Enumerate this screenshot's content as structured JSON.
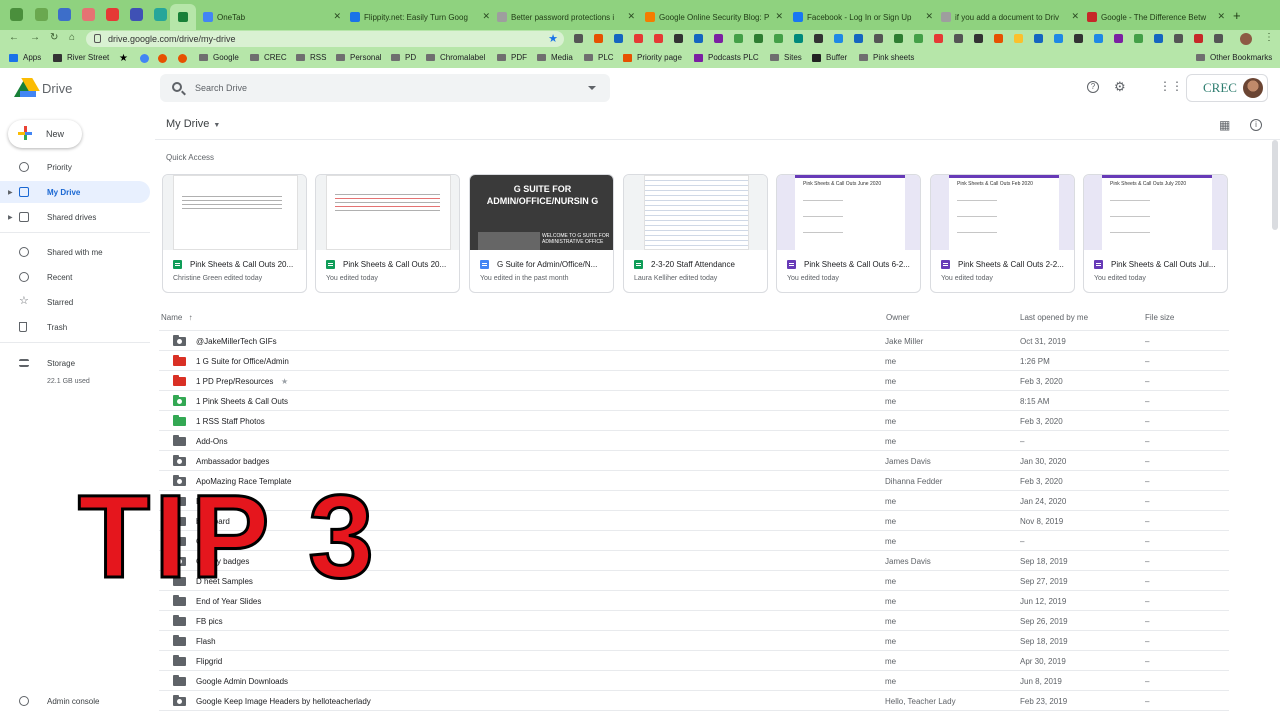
{
  "browser": {
    "tabs": [
      {
        "label": "OneTab",
        "color": "#4285f4"
      },
      {
        "label": "Flippity.net: Easily Turn Goog",
        "color": "#1a73e8"
      },
      {
        "label": "Better password protections i",
        "color": "#9e9e9e"
      },
      {
        "label": "Google Online Security Blog: P",
        "color": "#f57c00"
      },
      {
        "label": "Facebook - Log In or Sign Up",
        "color": "#1877f2"
      },
      {
        "label": "if you add a document to Driv",
        "color": "#9e9e9e"
      },
      {
        "label": "Google - The Difference Betw",
        "color": "#c62828"
      }
    ],
    "url": "drive.google.com/drive/my-drive",
    "bookmarks": [
      "Apps",
      "River Street",
      "Google",
      "CREC",
      "RSS",
      "Personal",
      "PD",
      "Chromalabel",
      "PDF",
      "Media",
      "PLC",
      "Priority page",
      "Podcasts PLC",
      "Sites",
      "Buffer",
      "Pink sheets"
    ],
    "other_bookmarks": "Other Bookmarks"
  },
  "header": {
    "app_name": "Drive",
    "search_placeholder": "Search Drive",
    "brand": "CREC"
  },
  "sidebar": {
    "new_label": "New",
    "items": [
      {
        "label": "Priority"
      },
      {
        "label": "My Drive"
      },
      {
        "label": "Shared drives"
      },
      {
        "label": "Shared with me"
      },
      {
        "label": "Recent"
      },
      {
        "label": "Starred"
      },
      {
        "label": "Trash"
      },
      {
        "label": "Storage"
      }
    ],
    "storage_used": "22.1 GB used",
    "admin_console": "Admin console"
  },
  "main": {
    "title": "My Drive",
    "quick_access_label": "Quick Access",
    "quick_access": [
      {
        "name": "Pink Sheets & Call Outs 20...",
        "sub": "Christine Green edited today",
        "type": "sheet"
      },
      {
        "name": "Pink Sheets & Call Outs 20...",
        "sub": "You edited today",
        "type": "sheet"
      },
      {
        "name": "G Suite for Admin/Office/N...",
        "sub": "You edited in the past month",
        "type": "doc",
        "banner": "G SUITE FOR ADMIN/OFFICE/NURSIN G",
        "welcome": "WELCOME TO G SUITE FOR ADMINISTRATIVE OFFICE"
      },
      {
        "name": "2-3-20 Staff Attendance",
        "sub": "Laura Kelliher edited today",
        "type": "sheet"
      },
      {
        "name": "Pink Sheets & Call Outs 6-2...",
        "sub": "You edited today",
        "type": "form",
        "form_title": "Pink Sheets & Call Outs June 2020"
      },
      {
        "name": "Pink Sheets & Call Outs 2-2...",
        "sub": "You edited today",
        "type": "form",
        "form_title": "Pink Sheets & Call Outs Feb 2020"
      },
      {
        "name": "Pink Sheets & Call Outs Jul...",
        "sub": "You edited today",
        "type": "form",
        "form_title": "Pink Sheets & Call Outs July 2020"
      }
    ],
    "columns": {
      "name": "Name",
      "owner": "Owner",
      "last_opened": "Last opened by me",
      "size": "File size"
    },
    "files": [
      {
        "name": "@JakeMillerTech GIFs",
        "owner": "Jake Miller",
        "opened": "Oct 31, 2019",
        "size": "–",
        "color": "#5f6368",
        "shared": true
      },
      {
        "name": "1 G Suite for Office/Admin",
        "owner": "me",
        "opened": "1:26 PM",
        "size": "–",
        "color": "#d93025",
        "shared": false
      },
      {
        "name": "1 PD Prep/Resources",
        "owner": "me",
        "opened": "Feb 3, 2020",
        "size": "–",
        "color": "#d93025",
        "shared": false,
        "starred": true
      },
      {
        "name": "1 Pink Sheets & Call Outs",
        "owner": "me",
        "opened": "8:15 AM",
        "size": "–",
        "color": "#33a853",
        "shared": true
      },
      {
        "name": "1 RSS Staff Photos",
        "owner": "me",
        "opened": "Feb 3, 2020",
        "size": "–",
        "color": "#33a853",
        "shared": false
      },
      {
        "name": "Add-Ons",
        "owner": "me",
        "opened": "–",
        "size": "–",
        "color": "#5f6368",
        "shared": false
      },
      {
        "name": "Ambassador badges",
        "owner": "James Davis",
        "opened": "Jan 30, 2020",
        "size": "–",
        "color": "#5f6368",
        "shared": true
      },
      {
        "name": "ApoMazing Race Template",
        "owner": "Dihanna Fedder",
        "opened": "Feb 3, 2020",
        "size": "–",
        "color": "#5f6368",
        "shared": true
      },
      {
        "name": "B",
        "owner": "me",
        "opened": "Jan 24, 2020",
        "size": "–",
        "color": "#5f6368",
        "shared": false
      },
      {
        "name": "b  n board",
        "owner": "me",
        "opened": "Nov 8, 2019",
        "size": "–",
        "color": "#5f6368",
        "shared": false
      },
      {
        "name": "C",
        "owner": "me",
        "opened": "–",
        "size": "–",
        "color": "#5f6368",
        "shared": false
      },
      {
        "name": "C    unity badges",
        "owner": "James Davis",
        "opened": "Sep 18, 2019",
        "size": "–",
        "color": "#5f6368",
        "shared": true
      },
      {
        "name": "D   heet Samples",
        "owner": "me",
        "opened": "Sep 27, 2019",
        "size": "–",
        "color": "#5f6368",
        "shared": false
      },
      {
        "name": "End of Year Slides",
        "owner": "me",
        "opened": "Jun 12, 2019",
        "size": "–",
        "color": "#5f6368",
        "shared": false
      },
      {
        "name": "FB pics",
        "owner": "me",
        "opened": "Sep 26, 2019",
        "size": "–",
        "color": "#5f6368",
        "shared": false
      },
      {
        "name": "Flash",
        "owner": "me",
        "opened": "Sep 18, 2019",
        "size": "–",
        "color": "#5f6368",
        "shared": false
      },
      {
        "name": "Flipgrid",
        "owner": "me",
        "opened": "Apr 30, 2019",
        "size": "–",
        "color": "#5f6368",
        "shared": false
      },
      {
        "name": "Google Admin Downloads",
        "owner": "me",
        "opened": "Jun 8, 2019",
        "size": "–",
        "color": "#5f6368",
        "shared": false
      },
      {
        "name": "Google Keep Image Headers by helloteacherlady",
        "owner": "Hello, Teacher Lady",
        "opened": "Feb 23, 2019",
        "size": "–",
        "color": "#5f6368",
        "shared": true
      }
    ]
  },
  "overlay": {
    "text": "TIP 3",
    "color": "#e5161d"
  }
}
